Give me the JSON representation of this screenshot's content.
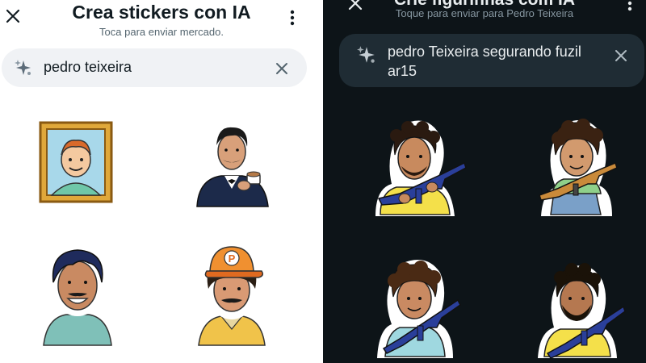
{
  "left_panel": {
    "title": "Crea stickers con IA",
    "subtitle": "Toca para enviar mercado.",
    "search_value": "pedro teixeira"
  },
  "right_panel": {
    "title": "Crie figurinhas com IA",
    "subtitle": "Toque para enviar para Pedro Teixeira",
    "search_value": "pedro Teixeira segurando fuzil ar15"
  },
  "colors": {
    "light_bg": "#ffffff",
    "dark_bg": "#0d1418",
    "search_light": "#f0f2f5",
    "search_dark": "#1f2c34"
  },
  "icons": {
    "close": "close-icon",
    "menu": "more-vertical-icon",
    "ai_sparkle": "ai-sparkle-icon",
    "clear": "clear-icon"
  }
}
